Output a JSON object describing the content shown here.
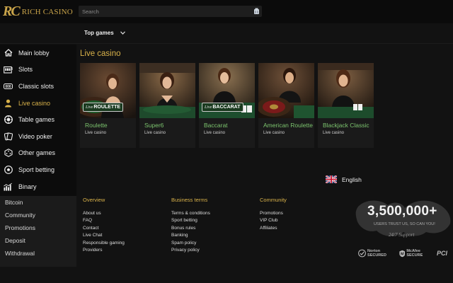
{
  "brand": {
    "name": "RICH CASINO",
    "mark": "RC",
    "color": "#c9a44a"
  },
  "search": {
    "placeholder": "Search"
  },
  "subnav": {
    "top_games": "Top games"
  },
  "sidebar": {
    "items": [
      {
        "label": "Main lobby",
        "icon": "home-icon",
        "active": false
      },
      {
        "label": "Slots",
        "icon": "slot-machine-icon",
        "active": false
      },
      {
        "label": "Classic slots",
        "icon": "classic-slot-icon",
        "active": false
      },
      {
        "label": "Live casino",
        "icon": "person-icon",
        "active": true
      },
      {
        "label": "Table games",
        "icon": "chip-icon",
        "active": false
      },
      {
        "label": "Video poker",
        "icon": "cards-icon",
        "active": false
      },
      {
        "label": "Other games",
        "icon": "dice-icon",
        "active": false
      },
      {
        "label": "Sport betting",
        "icon": "soccer-ball-icon",
        "active": false
      },
      {
        "label": "Binary",
        "icon": "chart-icon",
        "active": false
      }
    ],
    "sub_items": [
      "Bitcoin",
      "Community",
      "Promotions",
      "Deposit",
      "Withdrawal"
    ]
  },
  "main": {
    "section_title": "Live casino",
    "games": [
      {
        "name": "Roulette",
        "category": "Live casino",
        "badge": "ROULETTE"
      },
      {
        "name": "Super6",
        "category": "Live casino",
        "badge": ""
      },
      {
        "name": "Baccarat",
        "category": "Live casino",
        "badge": "BACCARAT"
      },
      {
        "name": "American Roulette",
        "category": "Live casino",
        "badge": ""
      },
      {
        "name": "Blackjack Classic",
        "category": "Live casino",
        "badge": ""
      }
    ],
    "badge_prefix": "Live"
  },
  "language": {
    "label": "English"
  },
  "footer": {
    "overview": {
      "heading": "Overview",
      "links": [
        "About us",
        "FAQ",
        "Contact",
        "Live Chat",
        "Responsible gaming",
        "Providers"
      ]
    },
    "business": {
      "heading": "Business terms",
      "links": [
        "Terms & conditions",
        "Sport betting",
        "Bonus rules",
        "Banking",
        "Spam policy",
        "Privacy policy"
      ]
    },
    "community": {
      "heading": "Community",
      "links": [
        "Promotions",
        "VIP Club",
        "Affiliates"
      ]
    }
  },
  "trust": {
    "count": "3,500,000+",
    "text": "USERS TRUST US, SO CAN YOU!",
    "support": "24/7 Support",
    "seals": [
      "Norton SECURED",
      "McAfee SECURE",
      "PCI"
    ]
  },
  "colors": {
    "accent": "#d9b24a",
    "game_title": "#7cc46e",
    "background": "#121212"
  }
}
